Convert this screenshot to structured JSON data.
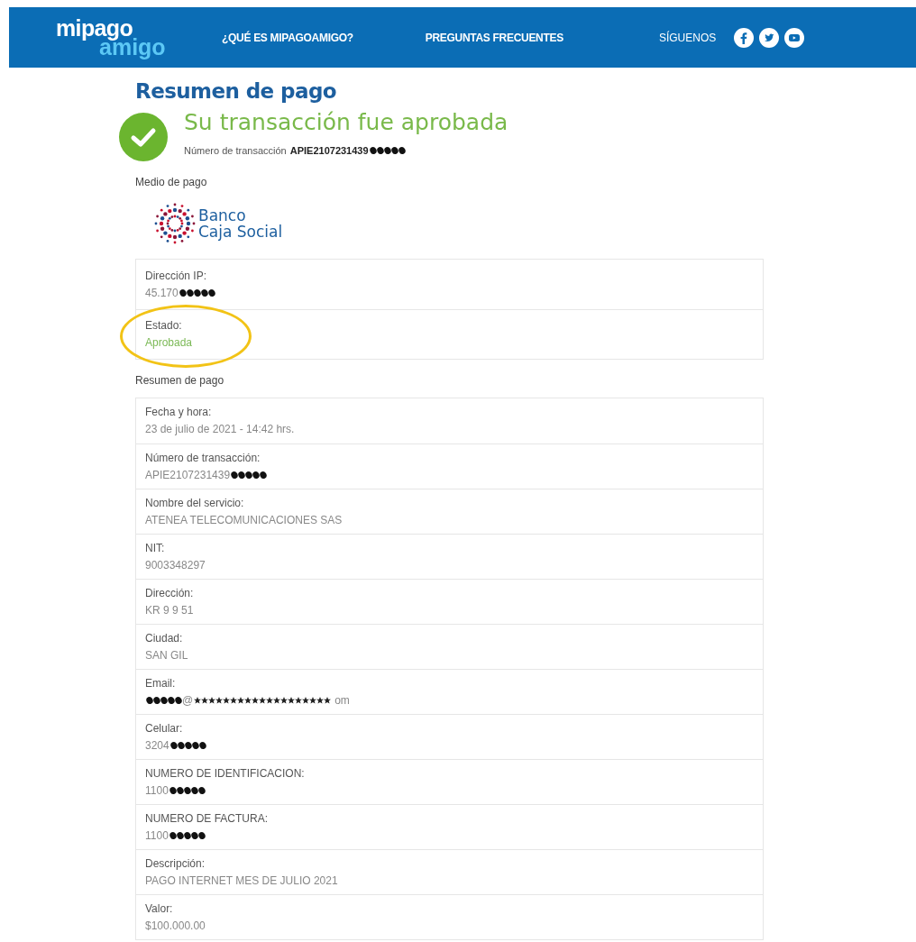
{
  "header": {
    "logo_top": "mipago",
    "logo_bottom": "amigo",
    "nav": [
      "¿QUÉ ES MIPAGOAMIGO?",
      "PREGUNTAS FRECUENTES"
    ],
    "follow_label": "SÍGUENOS",
    "social": [
      {
        "kind": "facebook"
      },
      {
        "kind": "twitter"
      },
      {
        "kind": "youtube"
      }
    ]
  },
  "title": "Resumen de pago",
  "status": {
    "message": "Su transacción fue aprobada",
    "number_label": "Número de transacción",
    "number_parts": [
      {
        "kind": "text",
        "text": "APIE2107231439"
      },
      {
        "kind": "redaction"
      }
    ]
  },
  "payment_method": {
    "label": "Medio de pago",
    "bank_line1": "Banco",
    "bank_line2": "Caja Social"
  },
  "details": [
    {
      "label": "Dirección IP:",
      "parts": [
        {
          "kind": "text",
          "text": "45.170"
        },
        {
          "kind": "redaction"
        }
      ],
      "highlighted": false,
      "approved": false
    },
    {
      "label": "Estado:",
      "parts": [
        {
          "kind": "text",
          "text": "Aprobada"
        }
      ],
      "highlighted": true,
      "approved": true
    }
  ],
  "summary_label": "Resumen de pago",
  "summary": [
    {
      "label": "Fecha y hora:",
      "parts": [
        {
          "kind": "text",
          "text": "23 de julio de 2021 - 14:42 hrs."
        }
      ]
    },
    {
      "label": "Número de transacción:",
      "parts": [
        {
          "kind": "text",
          "text": "APIE2107231439"
        },
        {
          "kind": "redaction"
        }
      ]
    },
    {
      "label": "Nombre del servicio:",
      "parts": [
        {
          "kind": "text",
          "text": "ATENEA TELECOMUNICACIONES SAS"
        }
      ]
    },
    {
      "label": "NIT:",
      "parts": [
        {
          "kind": "text",
          "text": "9003348297"
        }
      ]
    },
    {
      "label": "Dirección:",
      "parts": [
        {
          "kind": "text",
          "text": "KR 9 9 51"
        }
      ]
    },
    {
      "label": "Ciudad:",
      "parts": [
        {
          "kind": "text",
          "text": "SAN GIL"
        }
      ]
    },
    {
      "label": "Email:",
      "parts": [
        {
          "kind": "redaction"
        },
        {
          "kind": "text",
          "text": "@"
        },
        {
          "kind": "stars"
        },
        {
          "kind": "text",
          "text": "om"
        }
      ]
    },
    {
      "label": "Celular:",
      "parts": [
        {
          "kind": "text",
          "text": "3204"
        },
        {
          "kind": "redaction"
        }
      ]
    },
    {
      "label": "NUMERO DE IDENTIFICACION:",
      "parts": [
        {
          "kind": "text",
          "text": "1100"
        },
        {
          "kind": "redaction"
        }
      ]
    },
    {
      "label": "NUMERO DE FACTURA:",
      "parts": [
        {
          "kind": "text",
          "text": "1100"
        },
        {
          "kind": "redaction"
        }
      ]
    },
    {
      "label": "Descripción:",
      "parts": [
        {
          "kind": "text",
          "text": "PAGO INTERNET MES DE JULIO 2021"
        }
      ]
    },
    {
      "label": "Valor:",
      "parts": [
        {
          "kind": "text",
          "text": "$100.000.00"
        }
      ]
    }
  ]
}
